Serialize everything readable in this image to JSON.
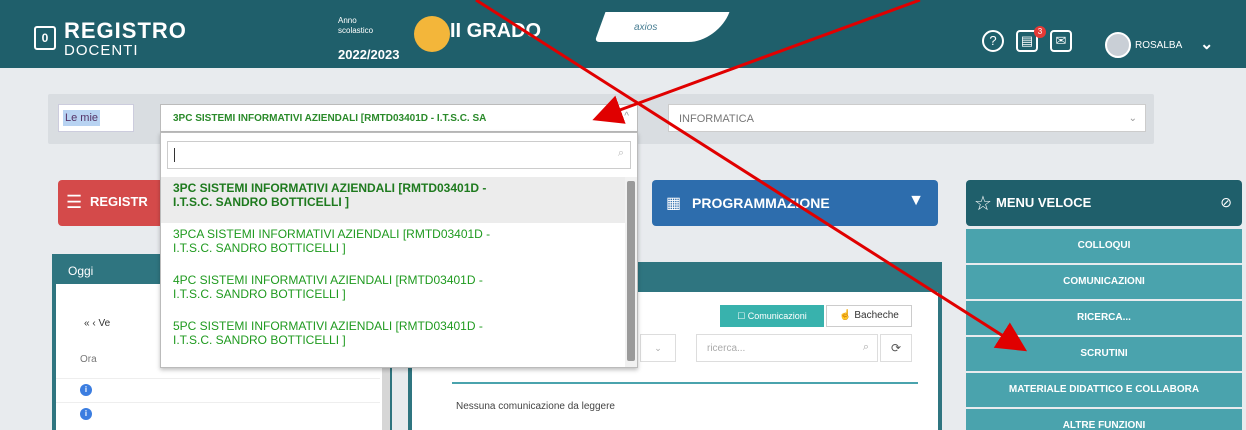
{
  "header": {
    "logo_glyph": "0",
    "brand_top": "REGISTRO",
    "brand_bottom": "DOCENTI",
    "anno_label": "Anno\nscolastico",
    "anno_value": "2022/2023",
    "grado": "II GRADO",
    "tab_label": "axios",
    "user_name": "ROSALBA",
    "mail_count": "3",
    "icons": [
      "help-icon",
      "calendar-icon",
      "mail-icon",
      "avatar",
      "chevron-down-icon"
    ]
  },
  "filter": {
    "left_chip": "Le mie",
    "class_select": "3PC SISTEMI INFORMATIVI AZIENDALI [RMTD03401D - I.T.S.C. SA",
    "subject_select": "INFORMATICA"
  },
  "dropdown": {
    "options": [
      "3PC SISTEMI INFORMATIVI AZIENDALI [RMTD03401D -\nI.T.S.C. SANDRO BOTTICELLI ]",
      "3PCA SISTEMI INFORMATIVI AZIENDALI [RMTD03401D -\nI.T.S.C. SANDRO BOTTICELLI ]",
      "4PC SISTEMI INFORMATIVI AZIENDALI [RMTD03401D -\nI.T.S.C. SANDRO BOTTICELLI ]",
      "5PC SISTEMI INFORMATIVI AZIENDALI [RMTD03401D -\nI.T.S.C. SANDRO BOTTICELLI ]"
    ]
  },
  "buttons": {
    "registro": "REGISTR",
    "programmazione": "PROGRAMMAZIONE"
  },
  "menu_veloce": {
    "title": "MENU VELOCE",
    "items": [
      "COLLOQUI",
      "COMUNICAZIONI",
      "RICERCA...",
      "SCRUTINI",
      "MATERIALE DIDATTICO E COLLABORA",
      "ALTRE FUNZIONI"
    ]
  },
  "oggi": {
    "title": "Oggi",
    "nav": "«  ‹       Ve",
    "ora_label": "Ora"
  },
  "center": {
    "comunicazioni_btn": "Comunicazioni",
    "bacheche_btn": "Bacheche",
    "search_placeholder": "ricerca...",
    "message": "Nessuna comunicazione da leggere"
  },
  "colors": {
    "header": "#1f5f6b",
    "red": "#d44a4a",
    "blue": "#2d6dad",
    "teal": "#4aa3ad",
    "green_text": "#1f9a1f",
    "arrow": "#e00000"
  }
}
